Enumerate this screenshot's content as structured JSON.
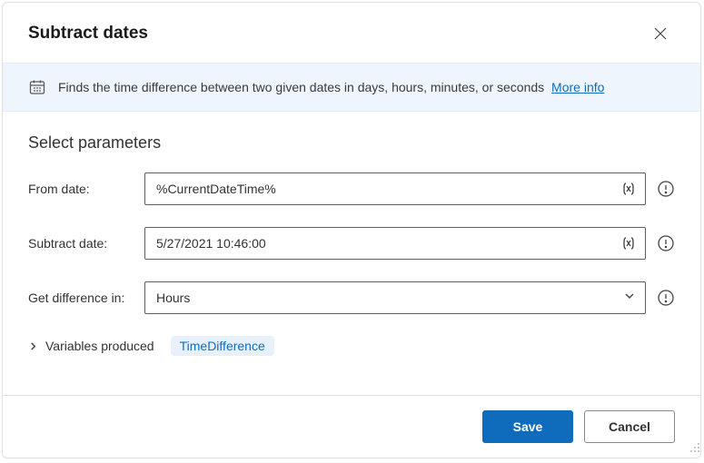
{
  "dialog": {
    "title": "Subtract dates",
    "description": "Finds the time difference between two given dates in days, hours, minutes, or seconds",
    "moreInfoLabel": "More info"
  },
  "section": {
    "title": "Select parameters"
  },
  "fields": {
    "fromDate": {
      "label": "From date:",
      "value": "%CurrentDateTime%"
    },
    "subtractDate": {
      "label": "Subtract date:",
      "value": "5/27/2021 10:46:00"
    },
    "getDifference": {
      "label": "Get difference in:",
      "selected": "Hours"
    }
  },
  "variables": {
    "label": "Variables produced",
    "chip": "TimeDifference"
  },
  "footer": {
    "save": "Save",
    "cancel": "Cancel"
  }
}
